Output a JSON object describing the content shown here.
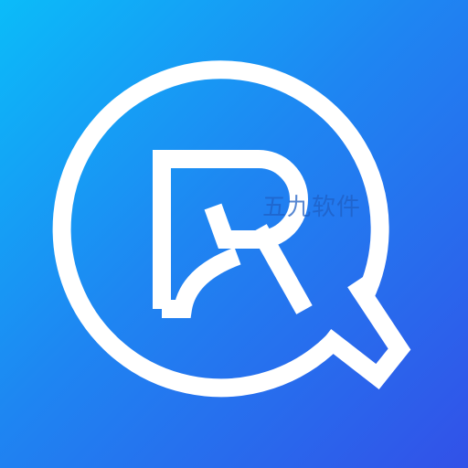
{
  "app_icon": {
    "name": "search-r-logo",
    "colors": {
      "gradient_start": "#0bbcf9",
      "gradient_mid": "#1e86f2",
      "gradient_end": "#3251e8",
      "mark": "#ffffff"
    },
    "icons": [
      "magnifier-ring-icon",
      "letter-r-icon"
    ]
  },
  "watermark": {
    "text": "五九软件"
  }
}
